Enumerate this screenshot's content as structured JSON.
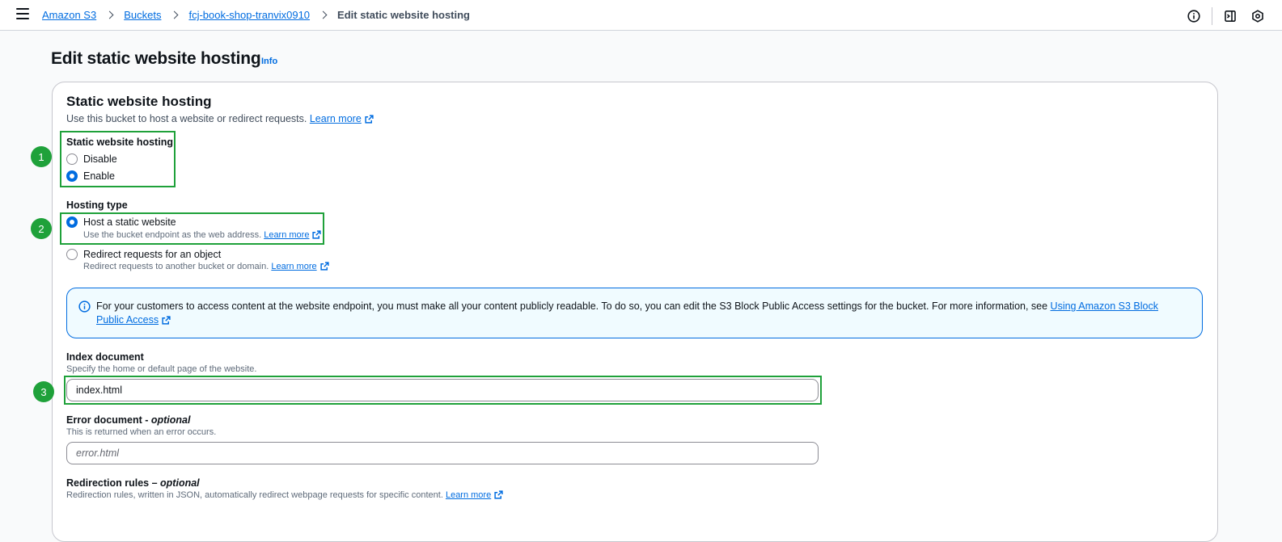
{
  "breadcrumb": {
    "items": [
      "Amazon S3",
      "Buckets",
      "fcj-book-shop-tranvix0910"
    ],
    "current": "Edit static website hosting"
  },
  "page": {
    "title": "Edit static website hosting",
    "info_label": "Info"
  },
  "section": {
    "title": "Static website hosting",
    "description": "Use this bucket to host a website or redirect requests.",
    "learn_more": "Learn more"
  },
  "hosting_toggle": {
    "label": "Static website hosting",
    "options": [
      "Disable",
      "Enable"
    ],
    "selected": "Enable"
  },
  "hosting_type": {
    "label": "Hosting type",
    "options": [
      {
        "label": "Host a static website",
        "description": "Use the bucket endpoint as the web address.",
        "link": "Learn more"
      },
      {
        "label": "Redirect requests for an object",
        "description": "Redirect requests to another bucket or domain.",
        "link": "Learn more"
      }
    ],
    "selected": "Host a static website"
  },
  "alert": {
    "text": "For your customers to access content at the website endpoint, you must make all your content publicly readable. To do so, you can edit the S3 Block Public Access settings for the bucket. For more information, see ",
    "link": "Using Amazon S3 Block Public Access"
  },
  "index_document": {
    "label": "Index document",
    "hint": "Specify the home or default page of the website.",
    "value": "index.html"
  },
  "error_document": {
    "label": "Error document",
    "optional": "optional",
    "separator": " - ",
    "hint": "This is returned when an error occurs.",
    "placeholder": "error.html"
  },
  "redirection_rules": {
    "label": "Redirection rules",
    "optional": "optional",
    "separator": " – ",
    "hint": "Redirection rules, written in JSON, automatically redirect webpage requests for specific content.",
    "link": "Learn more"
  },
  "annotations": [
    "1",
    "2",
    "3"
  ],
  "colors": {
    "link": "#006ce0",
    "highlight": "#1fa13a",
    "alert_bg": "#f0fbff"
  },
  "icons": {
    "menu": "hamburger-icon",
    "info": "info-circle-icon",
    "panel": "side-panel-icon",
    "settings": "hexagon-settings-icon",
    "external": "external-link-icon"
  }
}
